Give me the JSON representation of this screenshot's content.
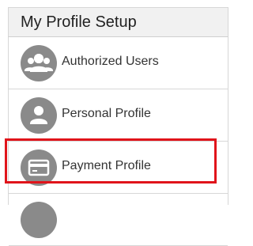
{
  "header": {
    "title": "My Profile Setup"
  },
  "menu": {
    "items": [
      {
        "label": "Authorized Users",
        "icon": "users-group-icon"
      },
      {
        "label": "Personal Profile",
        "icon": "person-icon"
      },
      {
        "label": "Payment Profile",
        "icon": "credit-card-icon"
      },
      {
        "label": "",
        "icon": "generic-icon"
      }
    ]
  },
  "colors": {
    "icon_circle": "#8a8a8a",
    "highlight": "#e0141b",
    "header_bg": "#f1f1f1"
  },
  "highlight": {
    "target": "Payment Profile"
  }
}
